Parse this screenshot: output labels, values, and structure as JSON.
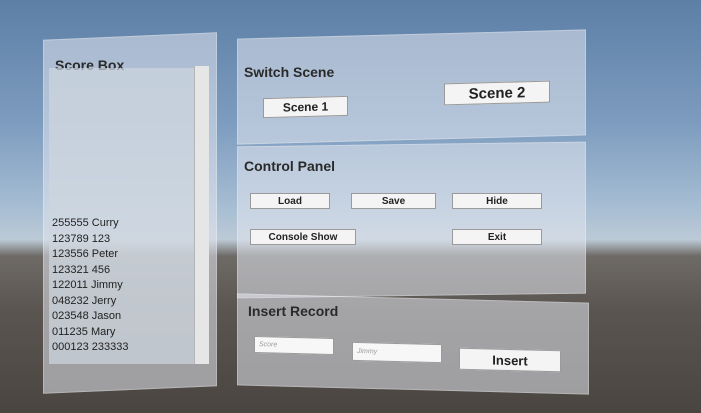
{
  "score_box": {
    "title": "Score Box",
    "records": [
      "255555 Curry",
      "123789 123",
      "123556 Peter",
      "123321 456",
      "122011 Jimmy",
      "048232 Jerry",
      "023548 Jason",
      "011235 Mary",
      "000123 233333"
    ]
  },
  "switch_scene": {
    "title": "Switch Scene",
    "scene1_label": "Scene 1",
    "scene2_label": "Scene 2"
  },
  "control_panel": {
    "title": "Control Panel",
    "load_label": "Load",
    "save_label": "Save",
    "hide_label": "Hide",
    "console_label": "Console Show",
    "exit_label": "Exit"
  },
  "insert_record": {
    "title": "Insert Record",
    "score_placeholder": "Score",
    "name_placeholder": "Jimmy",
    "insert_label": "Insert"
  }
}
